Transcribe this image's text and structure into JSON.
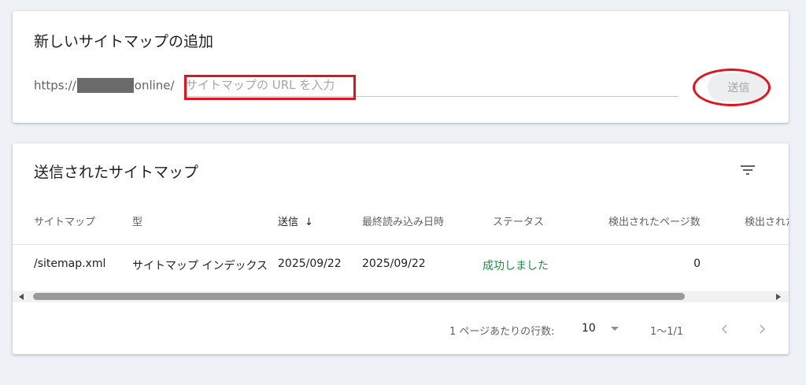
{
  "add_sitemap": {
    "title": "新しいサイトマップの追加",
    "url_prefix_start": "https://",
    "url_prefix_end": "online/",
    "input_placeholder": "サイトマップの URL を入力",
    "input_value": "",
    "submit_label": "送信"
  },
  "submitted": {
    "title": "送信されたサイトマップ",
    "filter_icon": "filter-icon",
    "columns": [
      "サイトマップ",
      "型",
      "送信",
      "最終読み込み日時",
      "ステータス",
      "検出されたページ数",
      "検出された"
    ],
    "sort_indicator": "↓",
    "rows": [
      {
        "sitemap": "/sitemap.xml",
        "type": "サイトマップ インデックス",
        "submitted": "2025/09/22",
        "last_read": "2025/09/22",
        "status": "成功しました",
        "pages": "0"
      }
    ],
    "pagination": {
      "rows_per_page_label": "1 ページあたりの行数:",
      "rows_per_page_value": "10",
      "range": "1〜1/1"
    }
  },
  "colors": {
    "status_success": "#1e8e3e",
    "annotation_red": "#e0141e",
    "page_background": "#eef1f6"
  }
}
